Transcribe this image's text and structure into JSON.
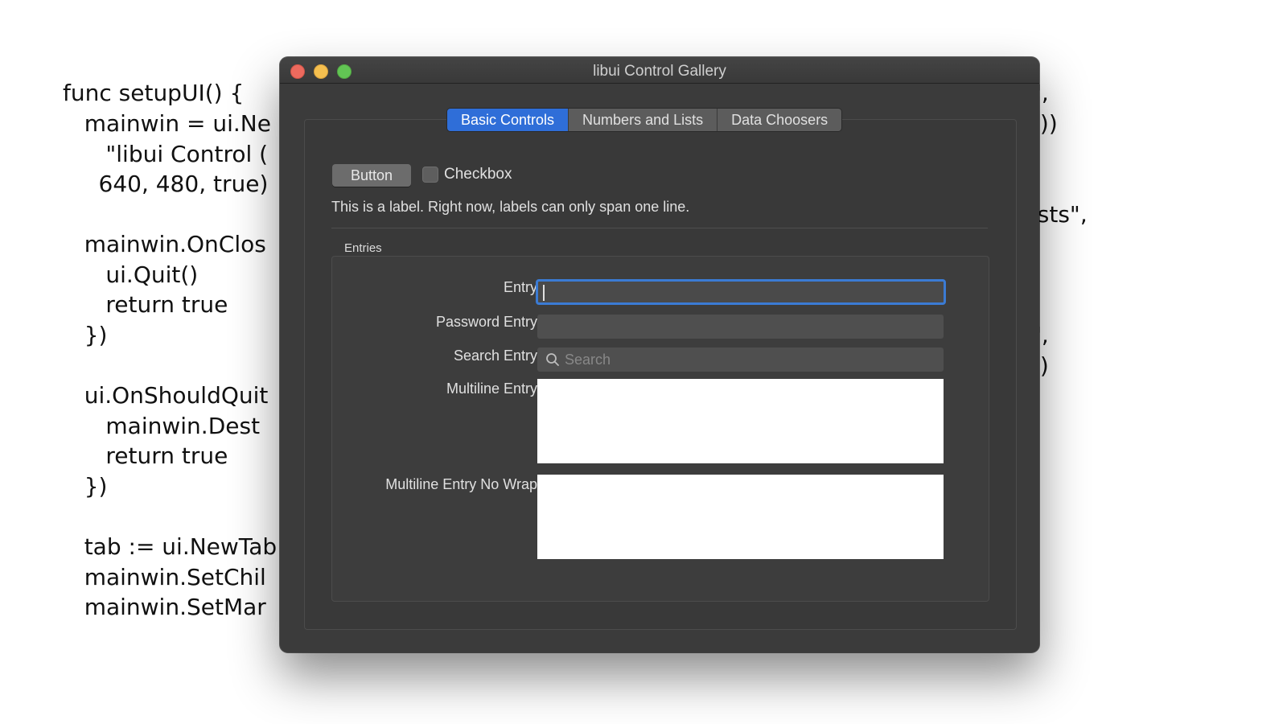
{
  "background_code": {
    "lines_left": [
      "func setupUI() {",
      "   mainwin = ui.Ne",
      "      \"libui Control (",
      "     640, 480, true)",
      "   mainwin.OnClos",
      "      ui.Quit()",
      "      return true",
      "   })",
      "   ui.OnShouldQuit",
      "      mainwin.Dest",
      "      return true",
      "   })",
      "   tab := ui.NewTab",
      "   mainwin.SetChil",
      "   mainwin.SetMar"
    ],
    "lines_right": [
      "\",",
      "())",
      "ists\",",
      "\",",
      "))"
    ]
  },
  "window": {
    "title": "libui Control Gallery",
    "tabs": [
      {
        "label": "Basic Controls",
        "active": true
      },
      {
        "label": "Numbers and Lists",
        "active": false
      },
      {
        "label": "Data Choosers",
        "active": false
      }
    ],
    "button_label": "Button",
    "checkbox_label": "Checkbox",
    "checkbox_checked": false,
    "label_text": "This is a label. Right now, labels can only span one line.",
    "group_title": "Entries",
    "form": {
      "entry_label": "Entry",
      "entry_value": "",
      "password_label": "Password Entry",
      "password_value": "",
      "search_label": "Search Entry",
      "search_placeholder": "Search",
      "multiline_label": "Multiline Entry",
      "multiline_nowrap_label": "Multiline Entry No Wrap"
    }
  },
  "colors": {
    "accent": "#2f6ed8",
    "focus_ring": "#3b7bd4",
    "window_bg": "#3b3b3b"
  }
}
